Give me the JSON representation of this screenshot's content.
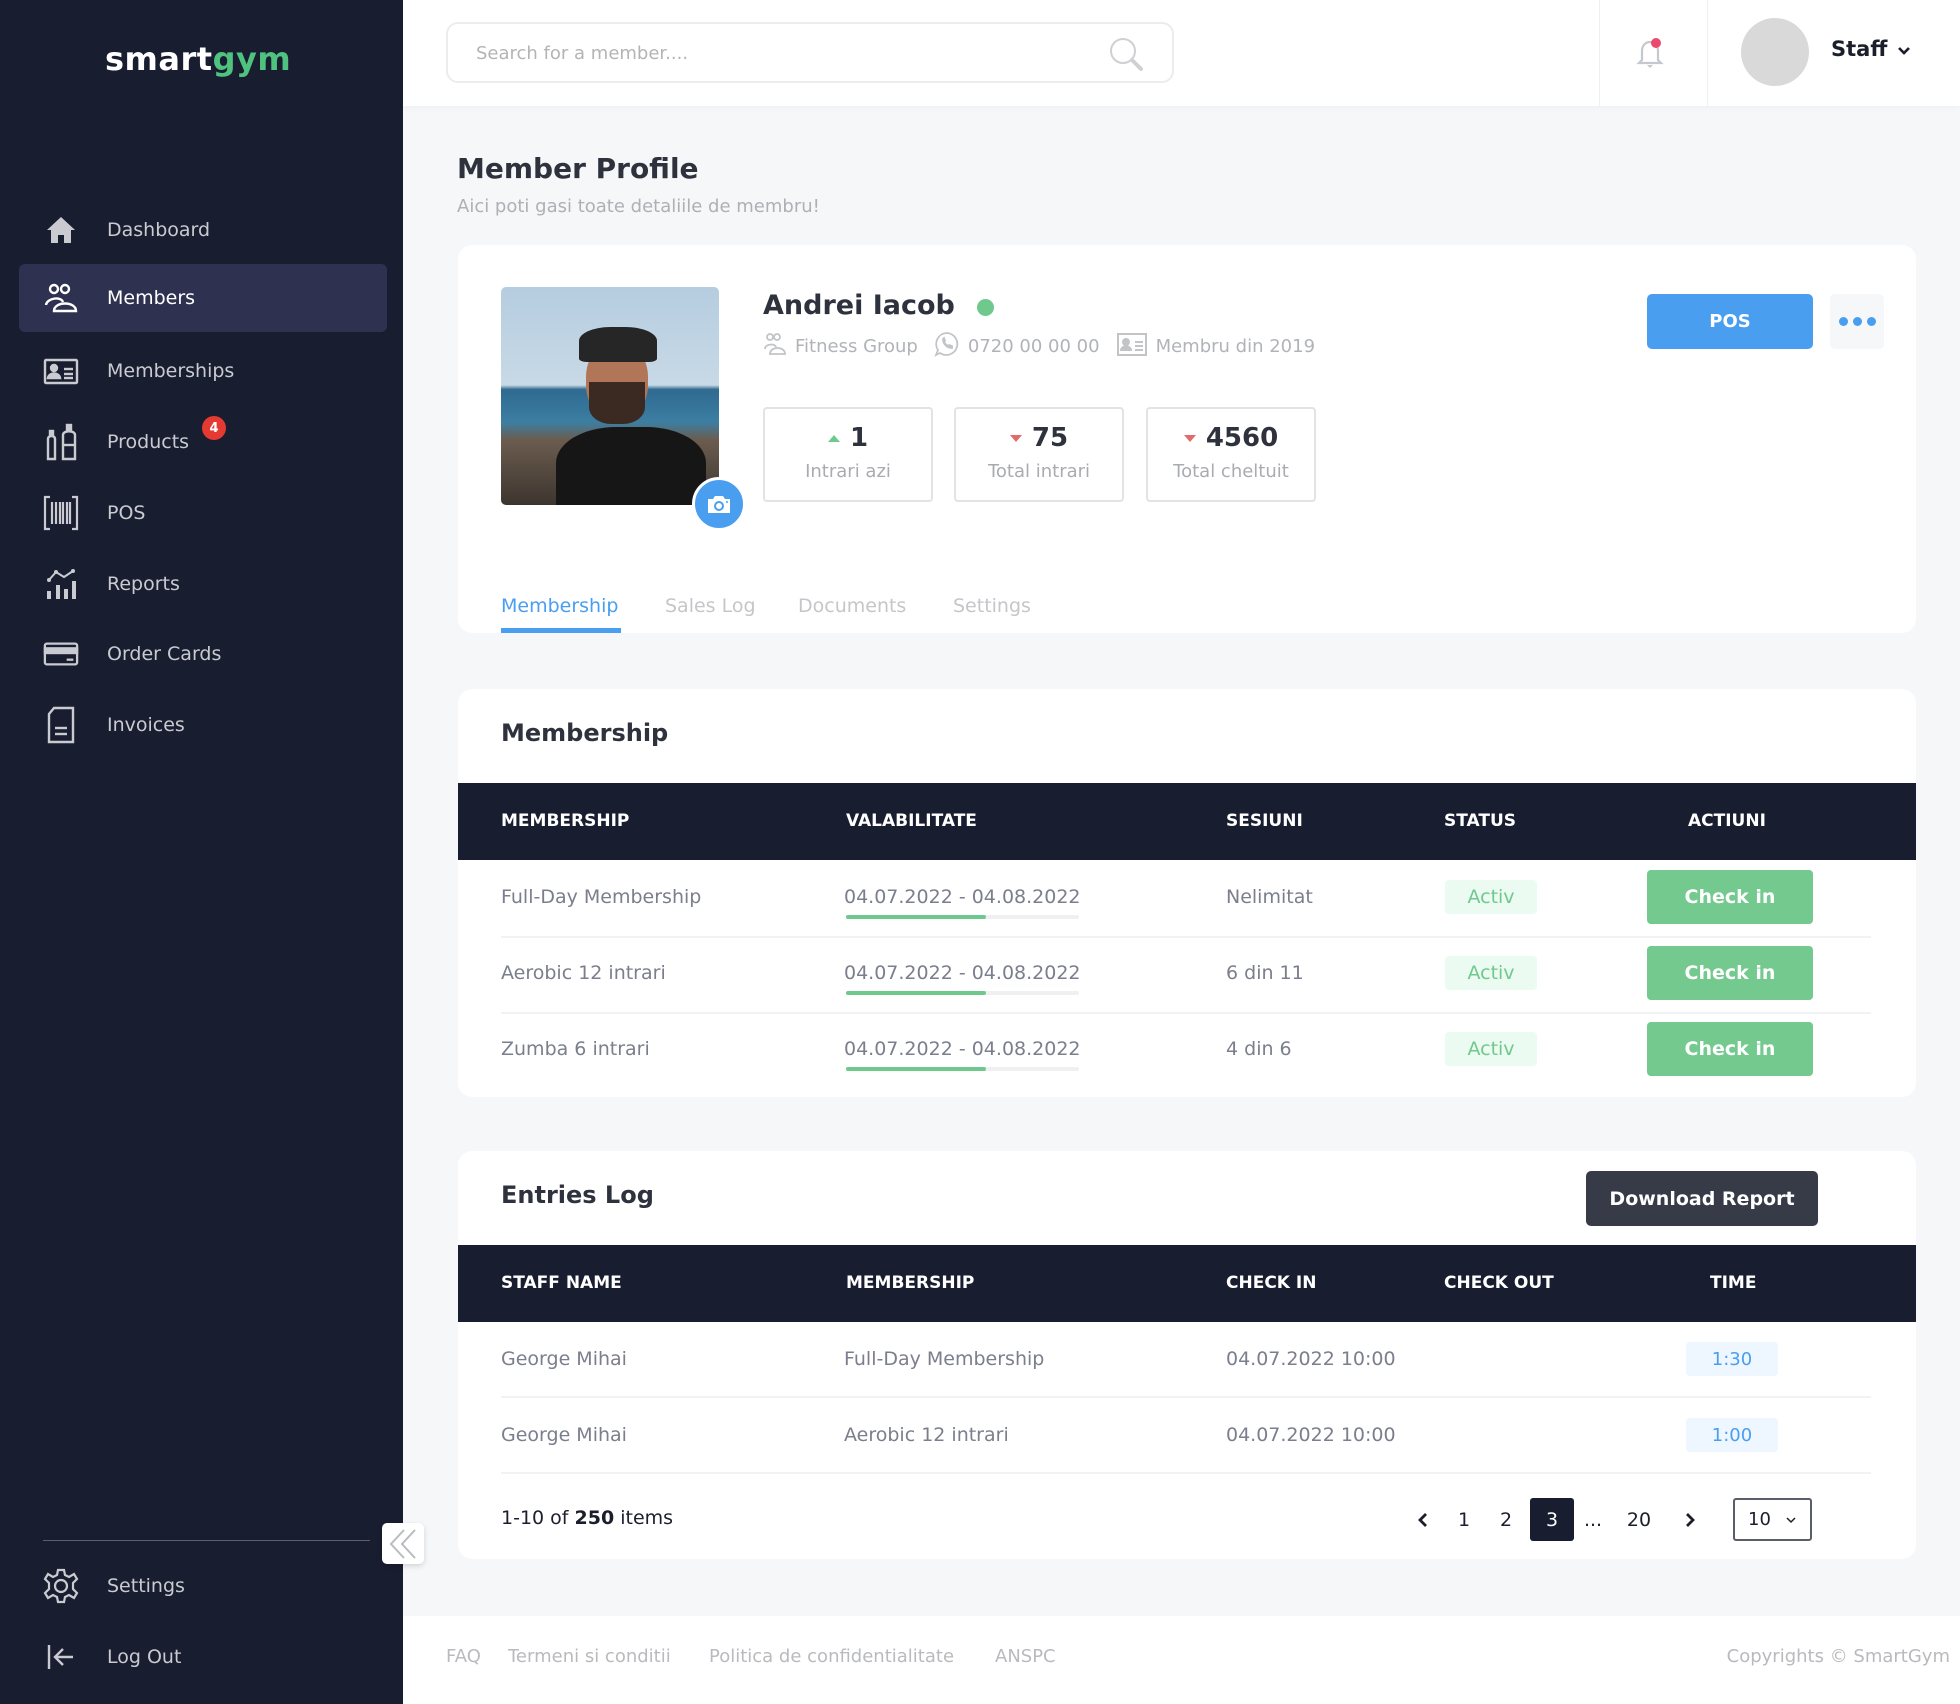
{
  "brand": {
    "part1": "smart",
    "part2": "gym",
    "accent": "#4fc27f"
  },
  "sidebar": {
    "items": [
      {
        "label": "Dashboard",
        "icon": "home-icon"
      },
      {
        "label": "Members",
        "icon": "members-icon",
        "active": true
      },
      {
        "label": "Memberships",
        "icon": "id-card-icon"
      },
      {
        "label": "Products",
        "icon": "bottles-icon",
        "badge": "4"
      },
      {
        "label": "POS",
        "icon": "barcode-icon"
      },
      {
        "label": "Reports",
        "icon": "chart-icon"
      },
      {
        "label": "Order Cards",
        "icon": "credit-card-icon"
      },
      {
        "label": "Invoices",
        "icon": "document-icon"
      }
    ],
    "bottom": [
      {
        "label": "Settings",
        "icon": "gear-icon"
      },
      {
        "label": "Log Out",
        "icon": "logout-icon"
      }
    ]
  },
  "topbar": {
    "search_placeholder": "Search for a member....",
    "user_label": "Staff"
  },
  "page": {
    "title": "Member Profile",
    "subtitle": "Aici poti gasi toate detaliile de membru!"
  },
  "profile": {
    "name": "Andrei Iacob",
    "status": "online",
    "group": "Fitness Group",
    "phone": "0720 00 00 00",
    "member_since": "Membru din 2019",
    "stats": [
      {
        "value": "1",
        "label": "Intrari azi",
        "trend": "up"
      },
      {
        "value": "75",
        "label": "Total intrari",
        "trend": "down"
      },
      {
        "value": "4560",
        "label": "Total cheltuit",
        "trend": "down"
      }
    ],
    "pos_label": "POS",
    "tabs": [
      "Membership",
      "Sales Log",
      "Documents",
      "Settings"
    ],
    "active_tab": "Membership"
  },
  "membership": {
    "title": "Membership",
    "columns": [
      "MEMBERSHIP",
      "VALABILITATE",
      "SESIUNI",
      "STATUS",
      "ACTIUNI"
    ],
    "rows": [
      {
        "name": "Full-Day Membership",
        "validity": "04.07.2022 - 04.08.2022",
        "progress": 0.6,
        "sessions": "Nelimitat",
        "status": "Activ",
        "action": "Check in"
      },
      {
        "name": "Aerobic 12 intrari",
        "validity": "04.07.2022 - 04.08.2022",
        "progress": 0.6,
        "sessions": "6 din 11",
        "status": "Activ",
        "action": "Check in"
      },
      {
        "name": "Zumba 6 intrari",
        "validity": "04.07.2022 - 04.08.2022",
        "progress": 0.6,
        "sessions": "4 din 6",
        "status": "Activ",
        "action": "Check in"
      }
    ]
  },
  "entries": {
    "title": "Entries Log",
    "download_label": "Download Report",
    "columns": [
      "STAFF NAME",
      "MEMBERSHIP",
      "CHECK IN",
      "CHECK OUT",
      "TIME"
    ],
    "rows": [
      {
        "staff": "George Mihai",
        "membership": "Full-Day Membership",
        "check_in": "04.07.2022 10:00",
        "check_out": "",
        "time": "1:30"
      },
      {
        "staff": "George Mihai",
        "membership": "Aerobic 12 intrari",
        "check_in": "04.07.2022 10:00",
        "check_out": "",
        "time": "1:00"
      }
    ],
    "pager": {
      "range": "1-10 of",
      "total": "250",
      "suffix": "items",
      "pages": [
        "1",
        "2",
        "3",
        "...",
        "20"
      ],
      "current": "3",
      "per_page": "10"
    }
  },
  "footer": {
    "links": [
      "FAQ",
      "Termeni si conditii",
      "Politica de confidentialitate",
      "ANSPC"
    ],
    "copyright": "Copyrights © SmartGym"
  },
  "colors": {
    "sidebar_bg": "#191d30",
    "primary_blue": "#4a9ef0",
    "success_green": "#74c98e",
    "danger_red": "#e43a32"
  }
}
